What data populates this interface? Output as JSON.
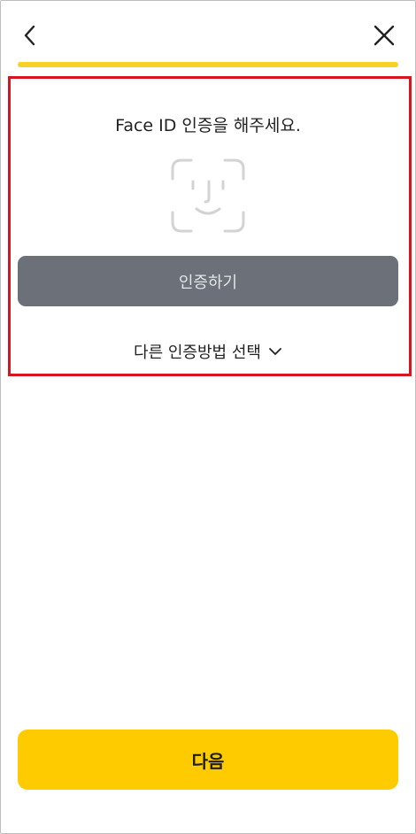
{
  "header": {
    "back_icon": "chevron-left-icon",
    "close_icon": "close-icon"
  },
  "progress": {
    "fraction": 1.0,
    "color": "#f5d223"
  },
  "face_id": {
    "prompt": "Face ID 인증을 해주세요.",
    "icon": "face-id-icon",
    "auth_button_label": "인증하기",
    "other_method_label": "다른 인증방법 선택",
    "other_method_icon": "chevron-down-icon"
  },
  "footer": {
    "next_label": "다음",
    "accent_color": "#fecb00"
  },
  "highlight_color": "#d8141e"
}
